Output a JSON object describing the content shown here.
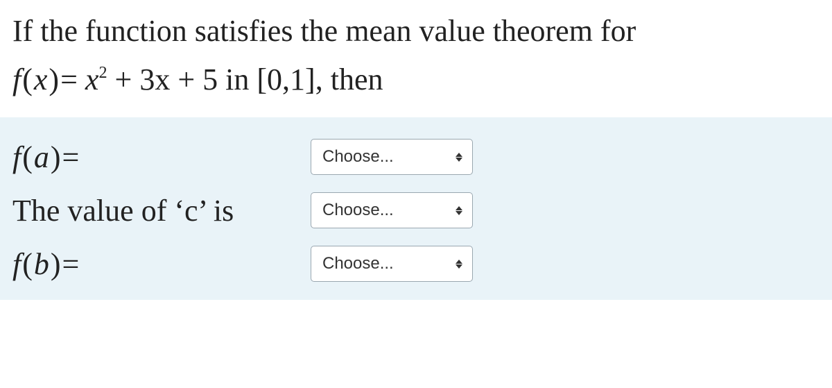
{
  "question": {
    "line1": "If the function satisfies the mean value theorem for",
    "func_lhs_f": "f",
    "func_lhs_x": "x",
    "func_rhs_pre": "= ",
    "func_rhs_x": "x",
    "func_rhs_sup": "2",
    "func_rhs_rest": " + 3x + 5",
    "in_word": " in ",
    "interval": "[0,1]",
    "then": ", then"
  },
  "rows": {
    "fa": {
      "f": "f",
      "arg": "a",
      "eq": "=",
      "choose": "Choose..."
    },
    "c": {
      "label": "The value of ‘c’ is",
      "choose": "Choose..."
    },
    "fb": {
      "f": "f",
      "arg": "b",
      "eq": "=",
      "choose": "Choose..."
    }
  }
}
